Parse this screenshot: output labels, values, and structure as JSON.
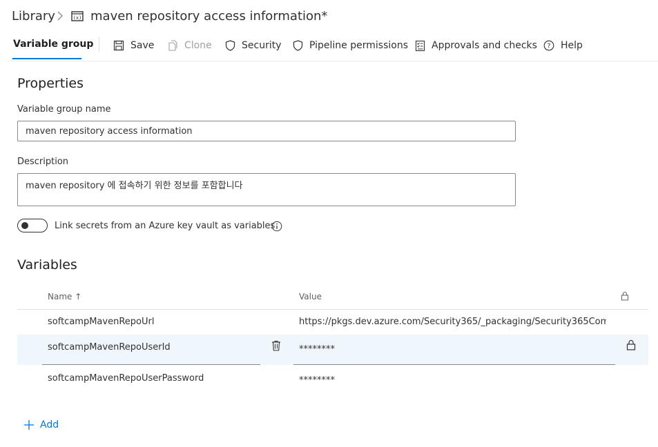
{
  "breadcrumb": {
    "library": "Library",
    "title": "maven repository access information*"
  },
  "toolbar": {
    "active_tab": "Variable group",
    "save": "Save",
    "clone": "Clone",
    "security": "Security",
    "pipeline_permissions": "Pipeline permissions",
    "approvals": "Approvals and checks",
    "help": "Help"
  },
  "properties": {
    "title": "Properties",
    "name_label": "Variable group name",
    "name_value": "maven repository access information",
    "description_label": "Description",
    "description_value": "maven repository 에 접속하기 위한 정보를 포함합니다",
    "keyvault_label": "Link secrets from an Azure key vault as variables",
    "keyvault_enabled": false
  },
  "variables": {
    "title": "Variables",
    "name_header": "Name ↑",
    "value_header": "Value",
    "rows": [
      {
        "name": "softcampMavenRepoUrl",
        "value": "https://pkgs.dev.azure.com/Security365/_packaging/Security365Com…",
        "secret": false
      },
      {
        "name": "softcampMavenRepoUserId",
        "value": "********",
        "secret": true
      },
      {
        "name": "softcampMavenRepoUserPassword",
        "value": "********",
        "secret": true
      }
    ],
    "add_label": "Add"
  },
  "colors": {
    "accent": "#0078d4",
    "selected_row": "#eff6fc",
    "text": "#323130",
    "disabled": "#a19f9d"
  },
  "icons": {
    "breadcrumb_separator": "chevron-right-icon",
    "variable_group": "variable-group-icon",
    "save": "save-icon",
    "clone": "clone-icon",
    "security": "shield-icon",
    "pipeline_permissions": "shield-icon",
    "approvals": "checklist-icon",
    "help": "help-icon",
    "info": "info-icon",
    "lock": "lock-icon",
    "delete": "trash-icon",
    "add": "plus-icon"
  }
}
